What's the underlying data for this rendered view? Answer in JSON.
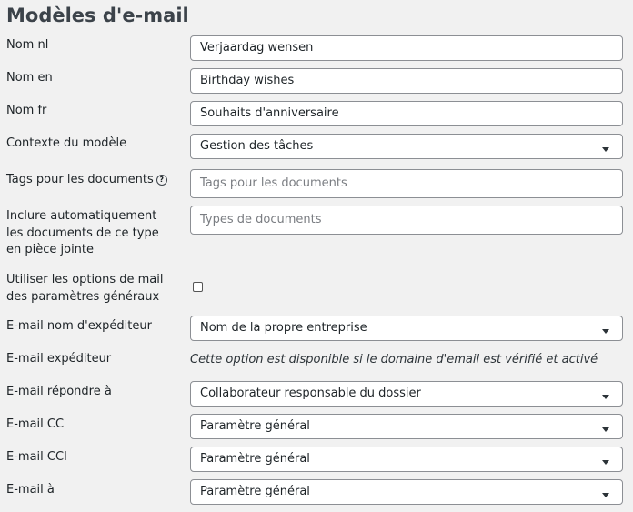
{
  "page": {
    "title": "Modèles d'e-mail"
  },
  "fields": {
    "nom_nl": {
      "label": "Nom nl",
      "value": "Verjaardag wensen"
    },
    "nom_en": {
      "label": "Nom en",
      "value": "Birthday wishes"
    },
    "nom_fr": {
      "label": "Nom fr",
      "value": "Souhaits d'anniversaire"
    },
    "contexte": {
      "label": "Contexte du modèle",
      "value": "Gestion des tâches"
    },
    "tags": {
      "label": "Tags pour les documents",
      "placeholder": "Tags pour les documents",
      "help": "?"
    },
    "inclure": {
      "label": "Inclure automatiquement les documents de ce type en pièce jointe",
      "placeholder": "Types de documents"
    },
    "utiliser": {
      "label": "Utiliser les options de mail des paramètres généraux",
      "checked": false
    },
    "expediteur_nom": {
      "label": "E-mail nom d'expéditeur",
      "value": "Nom de la propre entreprise"
    },
    "expediteur": {
      "label": "E-mail expéditeur",
      "note": "Cette option est disponible si le domaine d'email est vérifié et activé"
    },
    "repondre": {
      "label": "E-mail répondre à",
      "value": "Collaborateur responsable du dossier"
    },
    "cc": {
      "label": "E-mail CC",
      "value": "Paramètre général"
    },
    "cci": {
      "label": "E-mail CCI",
      "value": "Paramètre général"
    },
    "a": {
      "label": "E-mail à",
      "value": "Paramètre général"
    }
  },
  "icons": {
    "select": "chevron-down-icon",
    "help": "question-circle-icon"
  }
}
